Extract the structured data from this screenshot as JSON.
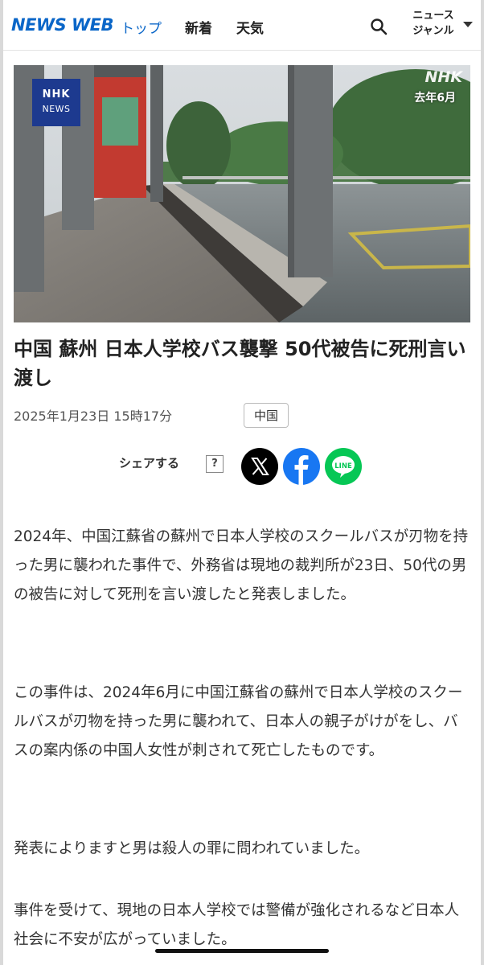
{
  "header": {
    "logo": "NEWS WEB",
    "nav": {
      "top": "トップ",
      "new": "新着",
      "weather": "天気"
    },
    "genre_line1": "ニュース",
    "genre_line2": "ジャンル",
    "search_icon": "search-icon"
  },
  "hero": {
    "badge_line1": "NHK",
    "badge_line2": "NEWS",
    "watermark": "NHK",
    "caption": "去年6月"
  },
  "article": {
    "title": "中国 蘇州 日本人学校バス襲撃 50代被告に死刑言い渡し",
    "date": "2025年1月23日 15時17分",
    "tag": "中国",
    "share_label": "シェアする",
    "help": "?",
    "paragraphs": [
      "2024年、中国江蘇省の蘇州で日本人学校のスクールバスが刃物を持った男に襲われた事件で、外務省は現地の裁判所が23日、50代の男の被告に対して死刑を言い渡したと発表しました。",
      "この事件は、2024年6月に中国江蘇省の蘇州で日本人学校のスクールバスが刃物を持った男に襲われて、日本人の親子がけがをし、バスの案内係の中国人女性が刺されて死亡したものです。",
      "発表によりますと男は殺人の罪に問われていました。",
      "事件を受けて、現地の日本人学校では警備が強化されるなど日本人社会に不安が広がっていました。"
    ]
  },
  "share": [
    "x-icon",
    "facebook-icon",
    "line-icon"
  ],
  "colors": {
    "brand": "#0a66c8",
    "nhk_blue": "#1d3a8f",
    "facebook": "#1877f2",
    "line": "#06c755"
  }
}
